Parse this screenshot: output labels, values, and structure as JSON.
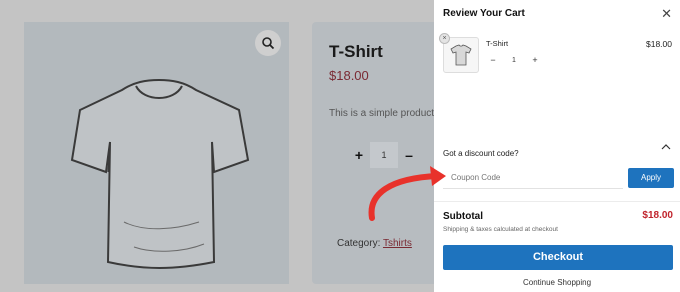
{
  "product_page": {
    "title": "T-Shirt",
    "price": "$18.00",
    "description": "This is a simple product",
    "quantity": "1",
    "qty_plus": "+",
    "qty_minus": "–",
    "category_label": "Category:",
    "category_link": "Tshirts"
  },
  "cart": {
    "title": "Review Your Cart",
    "close_glyph": "✕",
    "item": {
      "name": "T-Shirt",
      "price": "$18.00",
      "quantity": "1",
      "minus": "−",
      "plus": "+",
      "remove_glyph": "×"
    },
    "discount": {
      "label": "Got a discount code?",
      "placeholder": "Coupon Code",
      "apply_label": "Apply"
    },
    "subtotal_label": "Subtotal",
    "subtotal_value": "$18.00",
    "shipping_note": "Shipping & taxes calculated at checkout",
    "checkout_label": "Checkout",
    "continue_label": "Continue Shopping"
  },
  "colors": {
    "accent_blue": "#1e73be",
    "price_red": "#c0232c",
    "annotation_red": "#e8322b"
  }
}
